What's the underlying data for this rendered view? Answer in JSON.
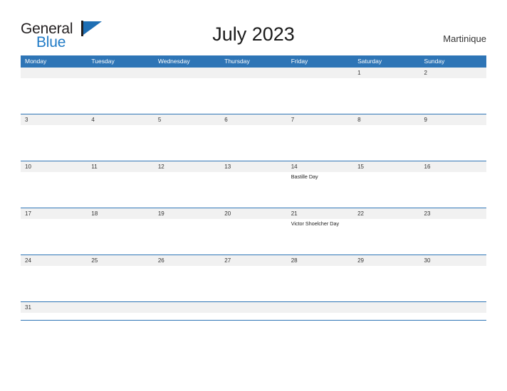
{
  "brand": {
    "word_one": "General",
    "word_two": "Blue",
    "flag_icon": "blue-triangle-flag-icon",
    "primary_color": "#2e75b6",
    "text_color": "#231f20"
  },
  "header": {
    "title": "July 2023",
    "location": "Martinique"
  },
  "calendar": {
    "weekdays": [
      "Monday",
      "Tuesday",
      "Wednesday",
      "Thursday",
      "Friday",
      "Saturday",
      "Sunday"
    ],
    "header_bg": "#2e75b6",
    "date_band_bg": "#f1f1f1",
    "rule_color": "#2e75b6",
    "weeks": [
      {
        "dates": [
          "",
          "",
          "",
          "",
          "",
          "1",
          "2"
        ],
        "events": [
          "",
          "",
          "",
          "",
          "",
          "",
          ""
        ]
      },
      {
        "dates": [
          "3",
          "4",
          "5",
          "6",
          "7",
          "8",
          "9"
        ],
        "events": [
          "",
          "",
          "",
          "",
          "",
          "",
          ""
        ]
      },
      {
        "dates": [
          "10",
          "11",
          "12",
          "13",
          "14",
          "15",
          "16"
        ],
        "events": [
          "",
          "",
          "",
          "",
          "Bastille Day",
          "",
          ""
        ]
      },
      {
        "dates": [
          "17",
          "18",
          "19",
          "20",
          "21",
          "22",
          "23"
        ],
        "events": [
          "",
          "",
          "",
          "",
          "Victor Shoelcher Day",
          "",
          ""
        ]
      },
      {
        "dates": [
          "24",
          "25",
          "26",
          "27",
          "28",
          "29",
          "30"
        ],
        "events": [
          "",
          "",
          "",
          "",
          "",
          "",
          ""
        ]
      },
      {
        "dates": [
          "31",
          "",
          "",
          "",
          "",
          "",
          ""
        ],
        "events": [
          "",
          "",
          "",
          "",
          "",
          "",
          ""
        ]
      }
    ]
  }
}
